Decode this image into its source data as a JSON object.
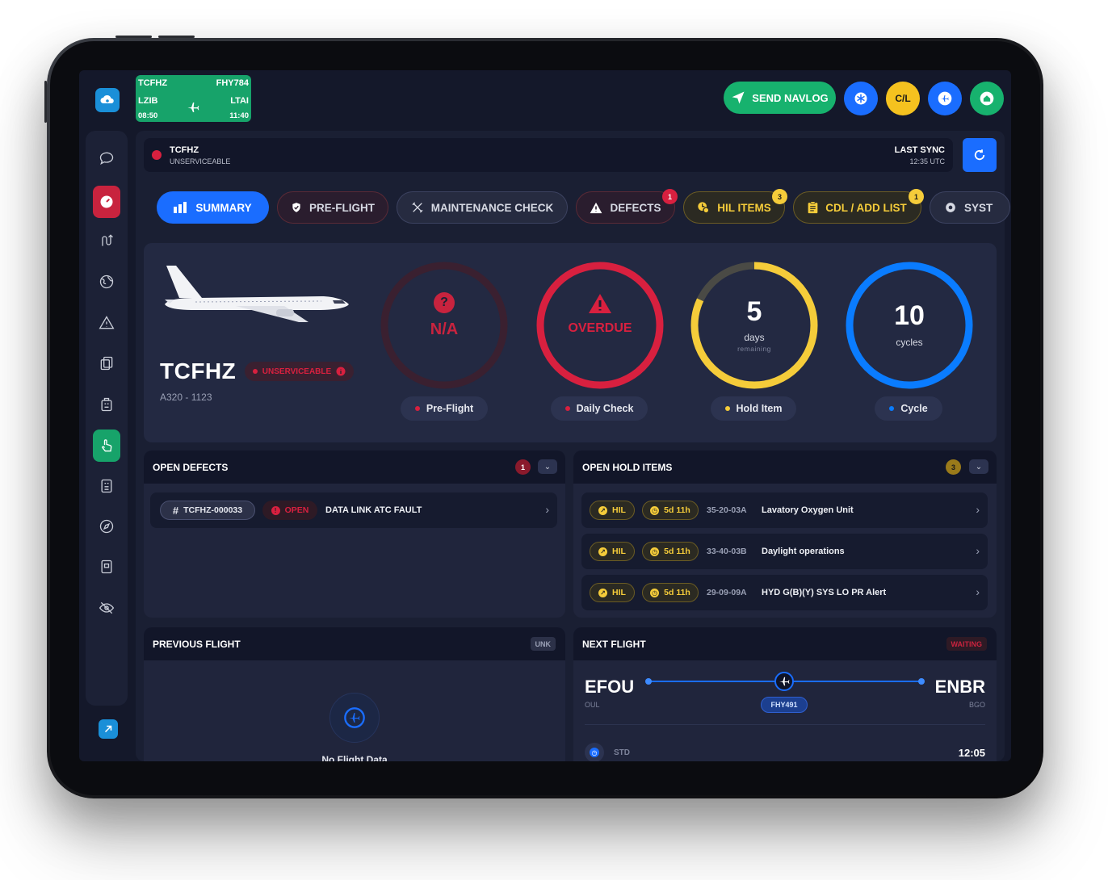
{
  "flight_card": {
    "registration": "TCFHZ",
    "flight_no": "FHY784",
    "origin": "LZIB",
    "destination": "LTAI",
    "dep_time": "08:50",
    "arr_time": "11:40"
  },
  "header_actions": {
    "send_navlog": "SEND NAVLOG",
    "cl_label": "C/L"
  },
  "status_bar": {
    "registration": "TCFHZ",
    "status": "UNSERVICEABLE",
    "last_sync_label": "LAST SYNC",
    "last_sync_time": "12:35 UTC"
  },
  "tabs": [
    {
      "label": "SUMMARY",
      "badge": null
    },
    {
      "label": "PRE-FLIGHT",
      "badge": null
    },
    {
      "label": "MAINTENANCE CHECK",
      "badge": null
    },
    {
      "label": "DEFECTS",
      "badge": "1"
    },
    {
      "label": "HIL ITEMS",
      "badge": "3"
    },
    {
      "label": "CDL / ADD LIST",
      "badge": "1"
    },
    {
      "label": "SYST",
      "badge": null
    }
  ],
  "aircraft": {
    "registration": "TCFHZ",
    "status_badge": "UNSERVICEABLE",
    "model": "A320 - 1123"
  },
  "gauges": [
    {
      "icon": "?",
      "value": "N/A",
      "label": "Pre-Flight",
      "color": "#d8203f",
      "progress": 0
    },
    {
      "icon": "!",
      "value": "OVERDUE",
      "label": "Daily Check",
      "color": "#d8203f",
      "progress": 1
    },
    {
      "value": "5",
      "unit": "days",
      "sub": "remaining",
      "label": "Hold Item",
      "color": "#f5cc3a",
      "progress": 0.82
    },
    {
      "value": "10",
      "unit": "cycles",
      "label": "Cycle",
      "color": "#0a7cff",
      "progress": 1
    }
  ],
  "open_defects": {
    "title": "OPEN DEFECTS",
    "count": "1",
    "items": [
      {
        "id": "TCFHZ-000033",
        "status": "OPEN",
        "description": "DATA LINK ATC FAULT"
      }
    ]
  },
  "open_hold_items": {
    "title": "OPEN HOLD ITEMS",
    "count": "3",
    "items": [
      {
        "type": "HIL",
        "time": "5d 11h",
        "code": "35-20-03A",
        "description": "Lavatory Oxygen Unit"
      },
      {
        "type": "HIL",
        "time": "5d 11h",
        "code": "33-40-03B",
        "description": "Daylight operations"
      },
      {
        "type": "HIL",
        "time": "5d 11h",
        "code": "29-09-09A",
        "description": "HYD G(B)(Y) SYS LO PR Alert"
      }
    ]
  },
  "previous_flight": {
    "title": "PREVIOUS FLIGHT",
    "badge": "UNK",
    "empty_text": "No Flight Data"
  },
  "next_flight": {
    "title": "NEXT FLIGHT",
    "badge": "WAITING",
    "origin": "EFOU",
    "origin_city": "OUL",
    "destination": "ENBR",
    "destination_city": "BGO",
    "flight_no": "FHY491",
    "std_label": "STD",
    "std_time": "12:05"
  },
  "colors": {
    "accent": "#1a6dff",
    "danger": "#d8203f",
    "warning": "#f5cc3a",
    "success": "#17a36a",
    "cycle": "#0a7cff"
  }
}
